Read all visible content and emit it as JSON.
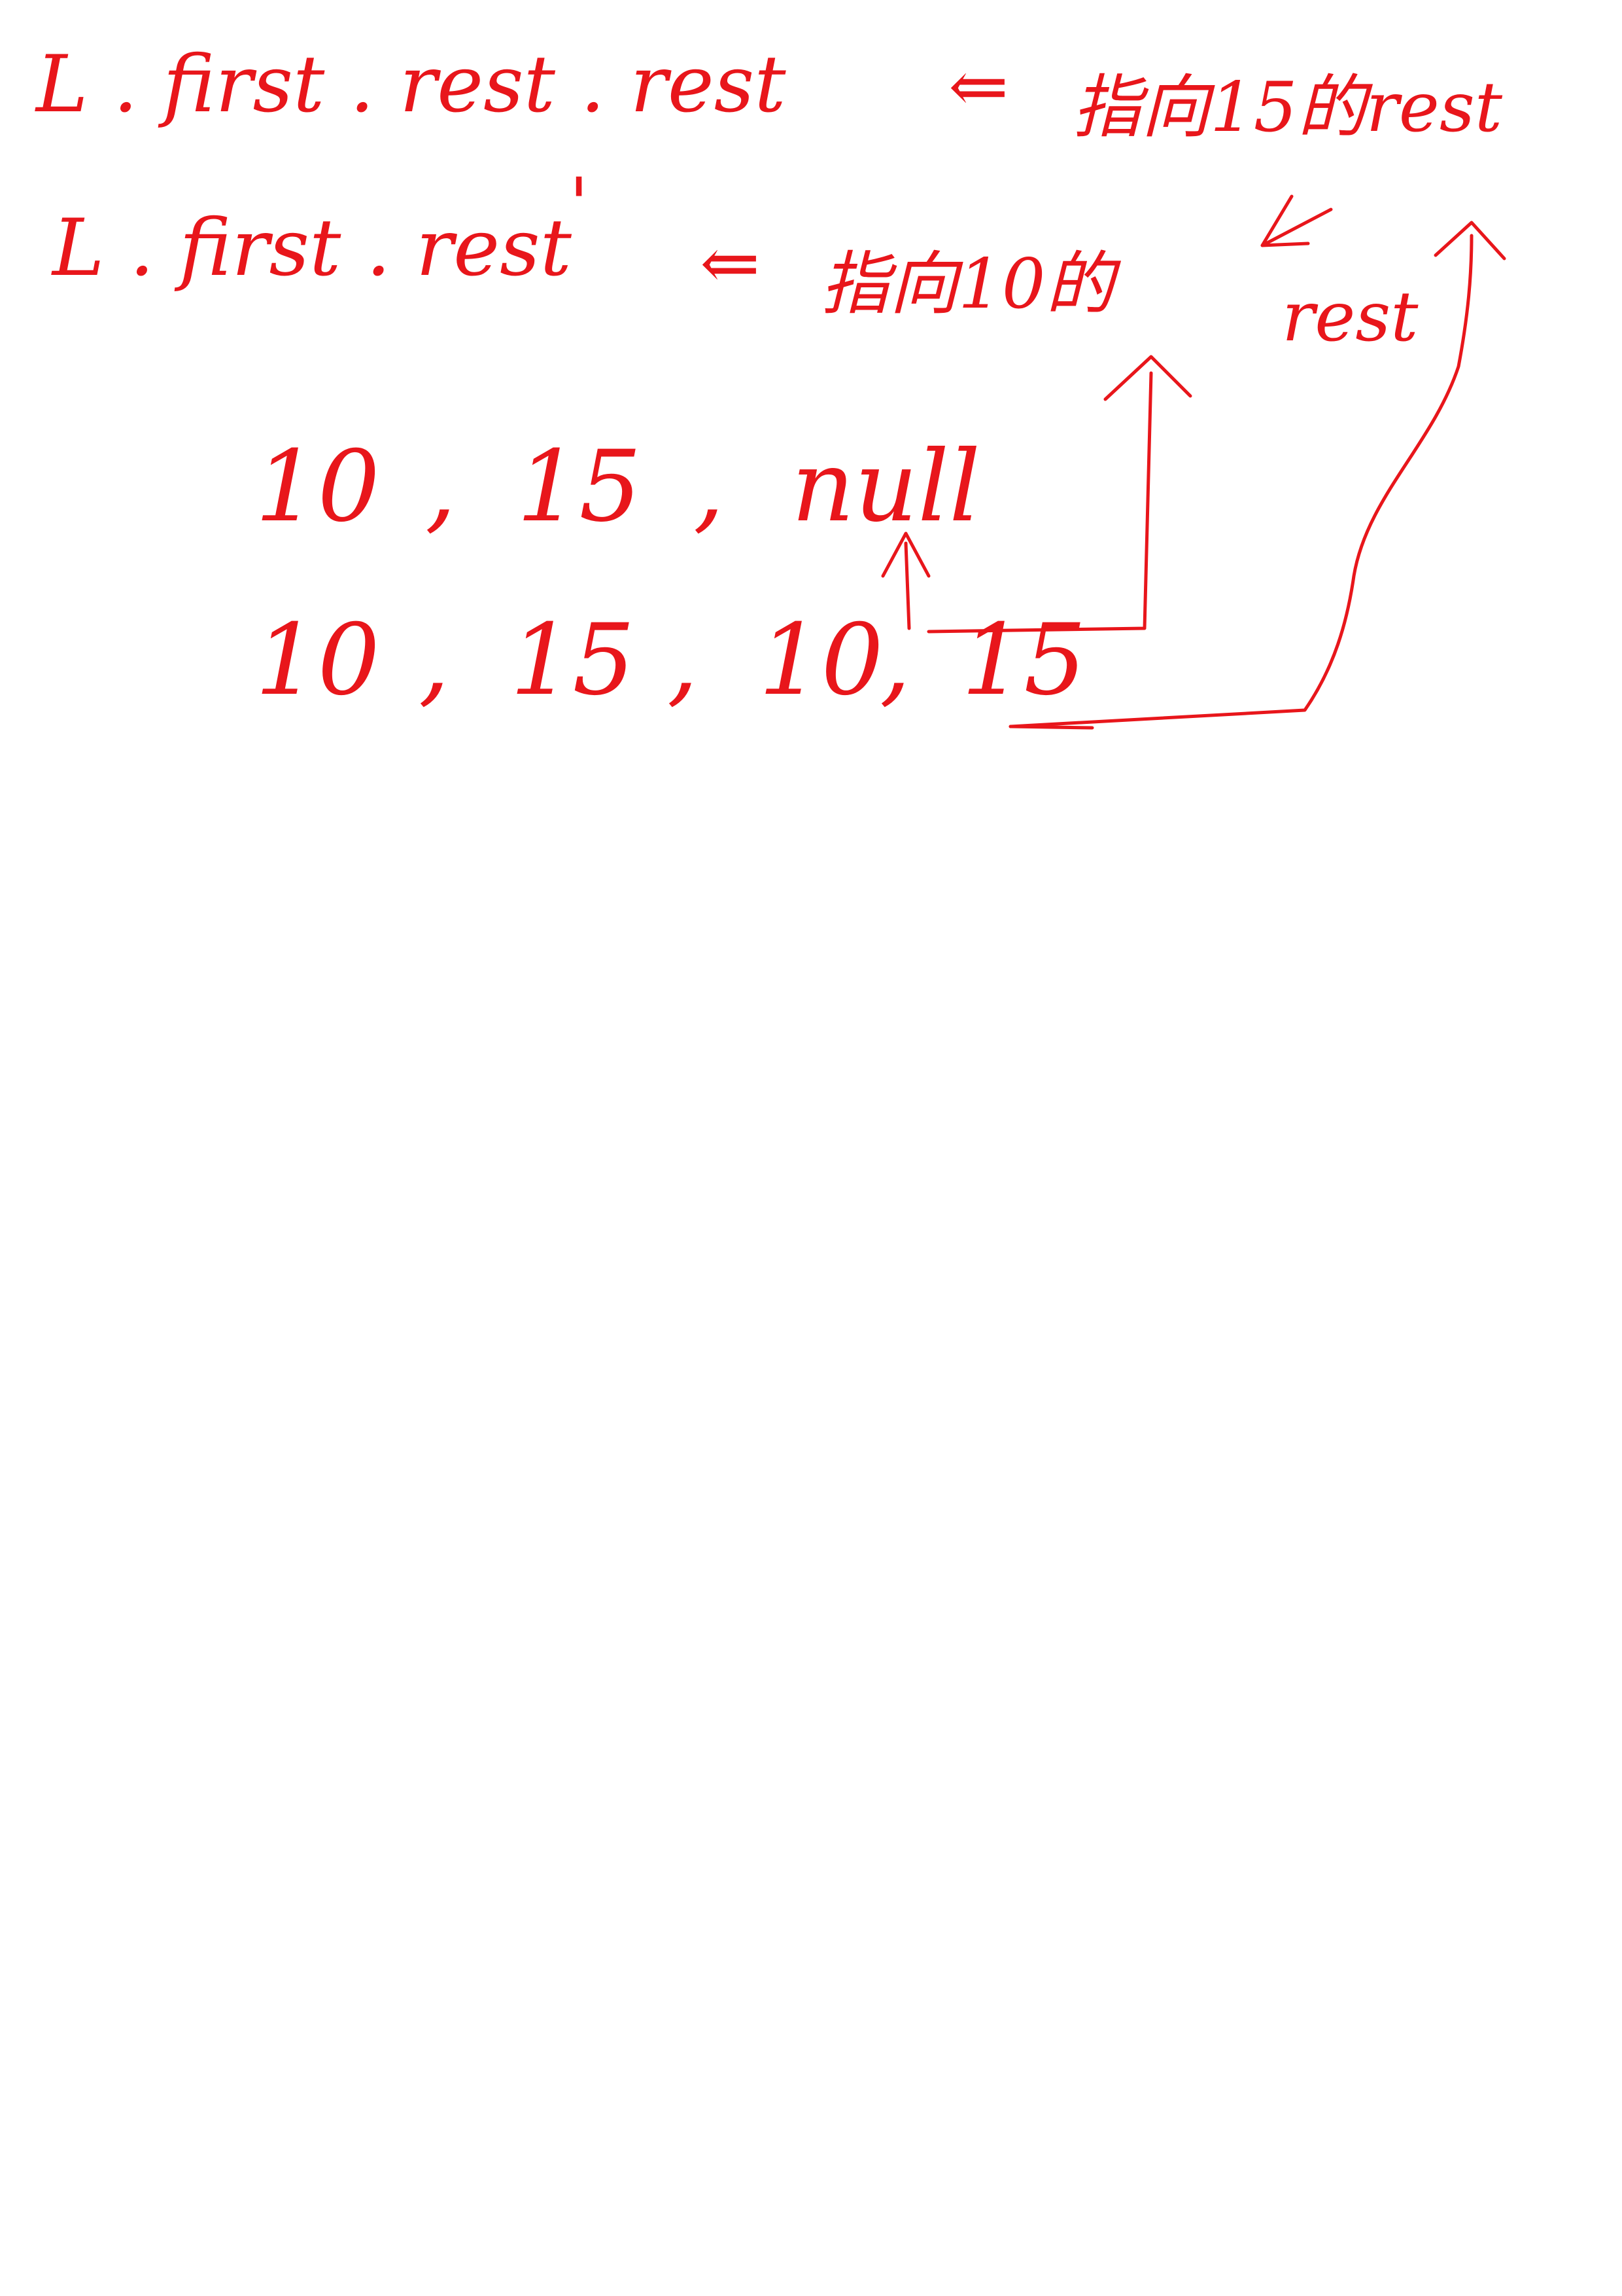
{
  "notes": {
    "line1": {
      "expr": "L . first . rest . rest",
      "arrow": "⇐",
      "annotation": "指向15的rest"
    },
    "line2": {
      "expr": "L . first . rest",
      "prime": "'",
      "arrow": "⇐",
      "annotation": "指向10的",
      "annotation2": "rest"
    },
    "list_before": {
      "items": [
        "10",
        ",",
        "15",
        ",",
        "null"
      ]
    },
    "list_after": {
      "items": [
        "10",
        ",",
        "15",
        ",",
        "10",
        ",",
        "15"
      ]
    }
  },
  "colors": {
    "ink": "#e8161b",
    "background": "#ffffff"
  }
}
